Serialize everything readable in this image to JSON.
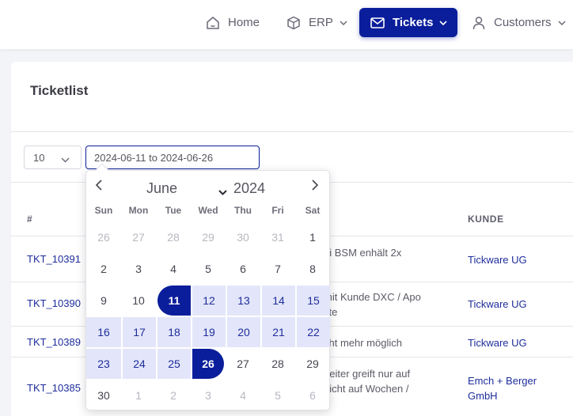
{
  "nav": {
    "home": "Home",
    "erp": "ERP",
    "tickets": "Tickets",
    "customers": "Customers"
  },
  "card": {
    "title": "Ticketlist",
    "per_page": "10",
    "date_range": "2024-06-11 to 2024-06-26"
  },
  "table": {
    "headers": {
      "hash": "#",
      "kunde": "KUNDE"
    },
    "rows": [
      {
        "id": "TKT_10391",
        "desc": "ei BSM enhält 2x",
        "kunde": "Tickware UG"
      },
      {
        "id": "TKT_10390",
        "desc": "mit Kunde DXC / Apo\nkte",
        "kunde": "Tickware UG"
      },
      {
        "id": "TKT_10389",
        "desc": "cht mehr möglich",
        "kunde": "Tickware UG"
      },
      {
        "id": "TKT_10385",
        "desc": "beiter greift nur auf\nnicht auf Wochen /",
        "kunde": "Emch + Berger\nGmbH"
      }
    ]
  },
  "calendar": {
    "month": "June",
    "year": "2024",
    "weekdays": [
      "Sun",
      "Mon",
      "Tue",
      "Wed",
      "Thu",
      "Fri",
      "Sat"
    ],
    "weeks": [
      [
        "26",
        "27",
        "28",
        "29",
        "30",
        "31",
        "1"
      ],
      [
        "2",
        "3",
        "4",
        "5",
        "6",
        "7",
        "8"
      ],
      [
        "9",
        "10",
        "11",
        "12",
        "13",
        "14",
        "15"
      ],
      [
        "16",
        "17",
        "18",
        "19",
        "20",
        "21",
        "22"
      ],
      [
        "23",
        "24",
        "25",
        "26",
        "27",
        "28",
        "29"
      ],
      [
        "30",
        "1",
        "2",
        "3",
        "4",
        "5",
        "6"
      ]
    ],
    "range_start": "11",
    "range_end": "26"
  },
  "colors": {
    "accent": "#0a1e9b",
    "range": "#e3e6fa"
  }
}
